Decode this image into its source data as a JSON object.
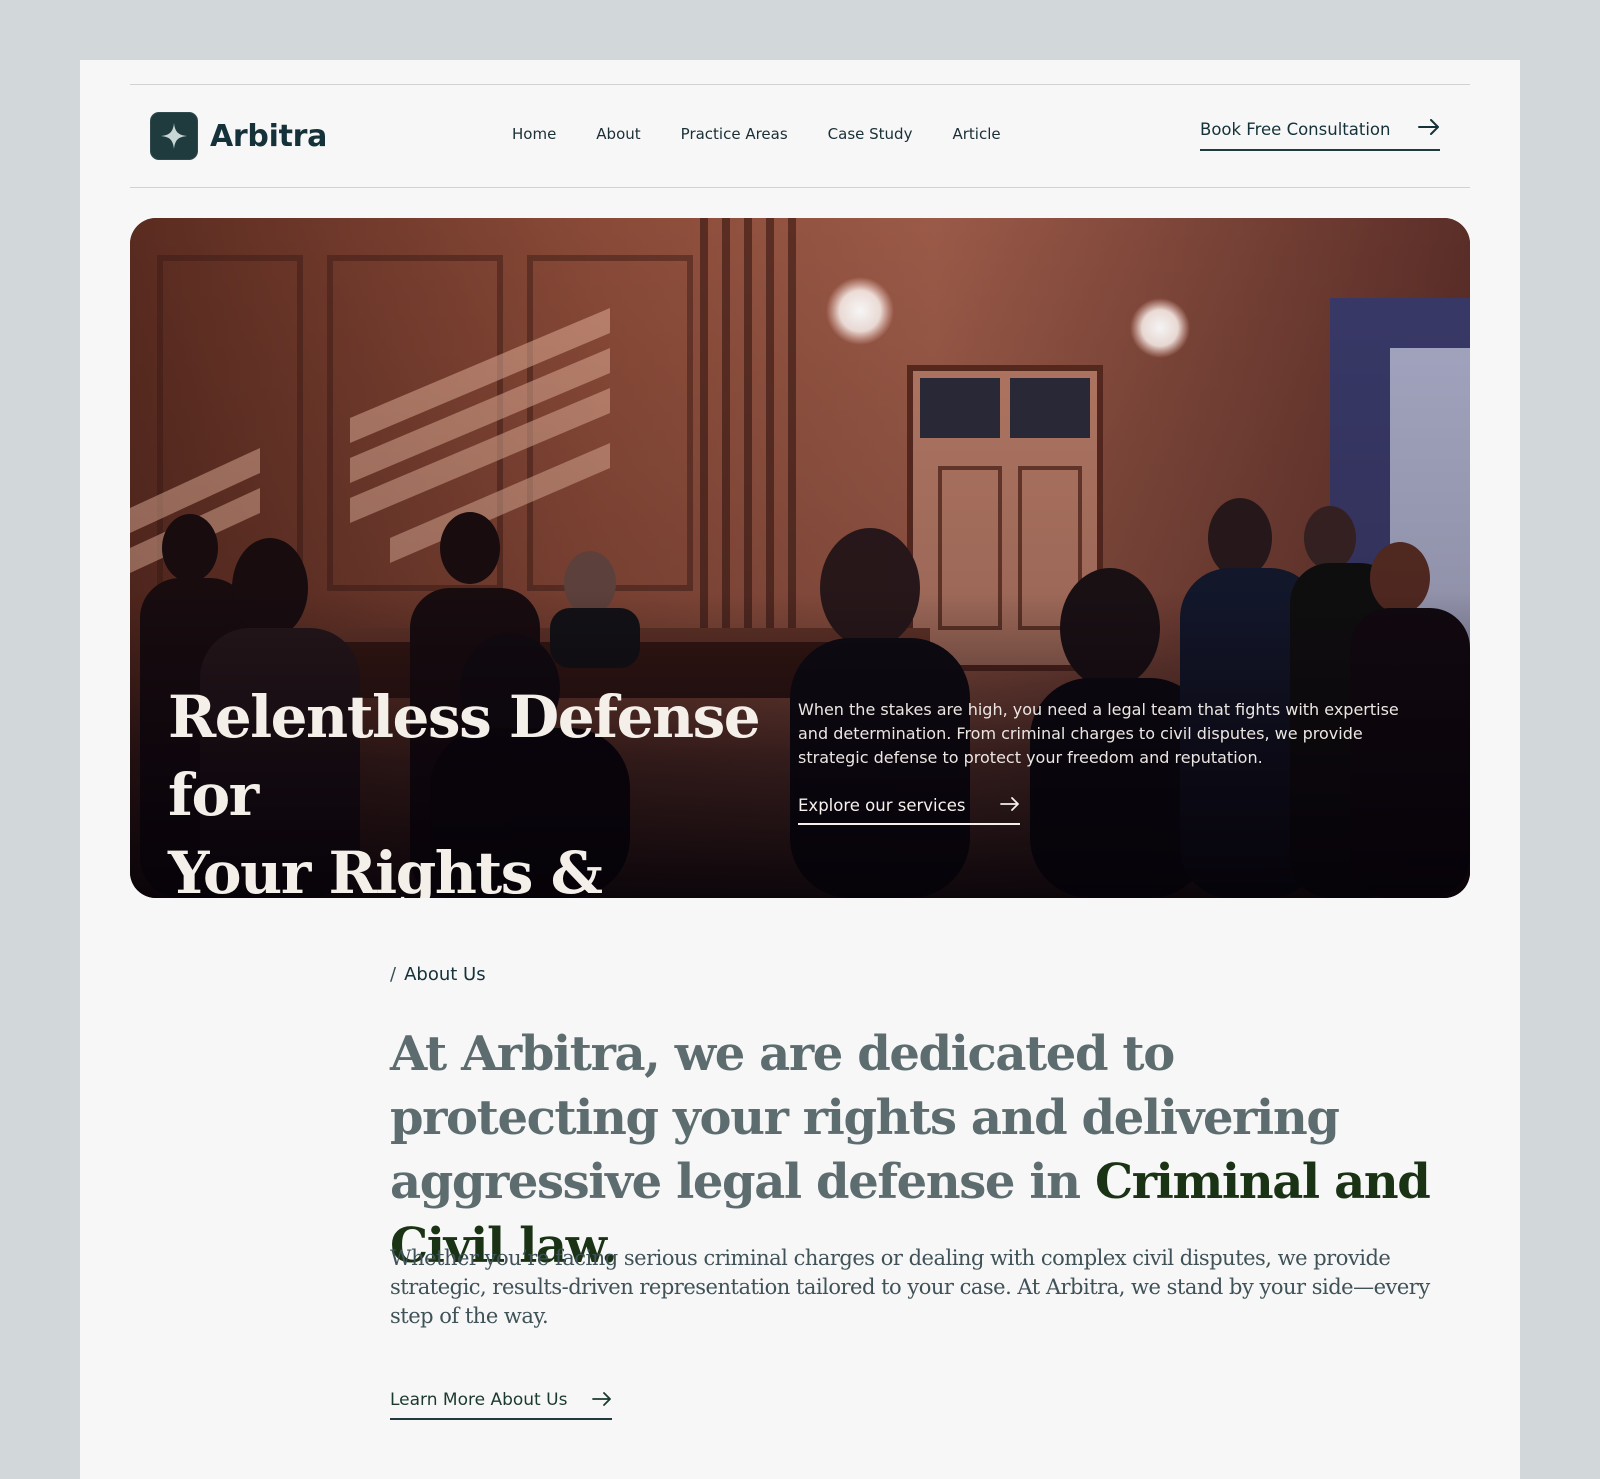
{
  "brand": {
    "name": "Arbitra"
  },
  "nav": {
    "items": [
      {
        "label": "Home"
      },
      {
        "label": "About"
      },
      {
        "label": "Practice Areas"
      },
      {
        "label": "Case Study"
      },
      {
        "label": "Article"
      }
    ]
  },
  "header": {
    "cta_label": "Book Free Consultation"
  },
  "hero": {
    "title_line1": "Relentless Defense for",
    "title_line2": "Your Rights & Future",
    "description": "When the stakes are high, you need a legal team that fights with expertise and determination. From criminal charges to civil disputes, we provide strategic defense to protect your freedom and reputation.",
    "link_label": "Explore our services"
  },
  "about": {
    "eyebrow": "About Us",
    "heading_main": "At Arbitra, we are dedicated to protecting your rights and delivering aggressive legal defense in ",
    "heading_accent": "Criminal and Civil law.",
    "body": "Whether you’re facing serious criminal charges or dealing with complex civil disputes, we provide strategic, results-driven representation tailored to your case. At Arbitra, we stand by your side—every step of the way.",
    "link_label": "Learn More About Us"
  },
  "colors": {
    "brand_dark": "#15323a",
    "accent_green": "#1a3315",
    "muted_heading": "#5d6d6f",
    "page_bg": "#f7f7f7",
    "outer_bg": "#d2d7da"
  },
  "icons": {
    "logo": "four-point-star-icon",
    "cta": "arrow-right-icon"
  }
}
